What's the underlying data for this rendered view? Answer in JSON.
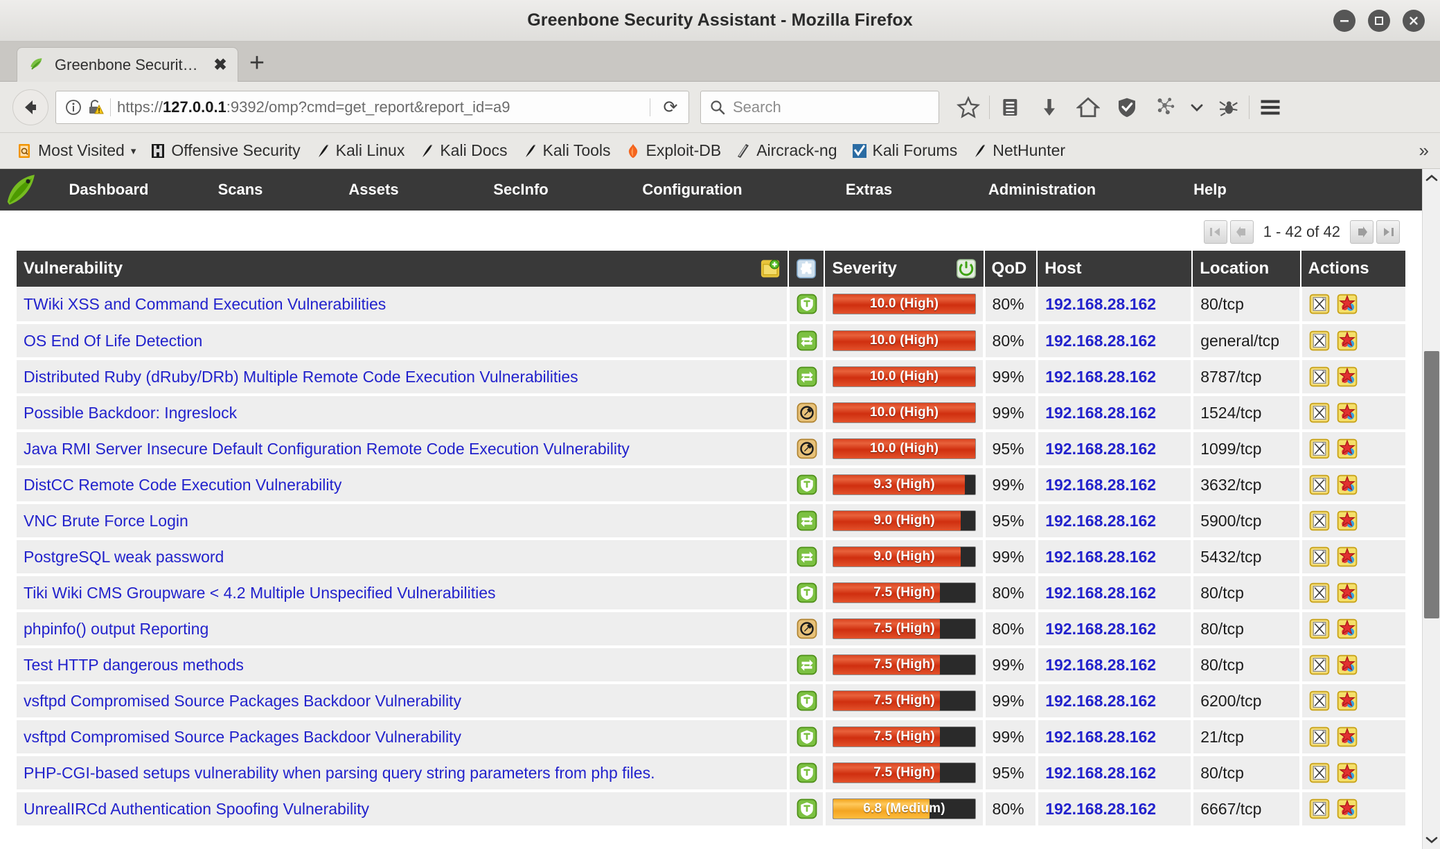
{
  "window": {
    "title": "Greenbone Security Assistant - Mozilla Firefox",
    "minimize": "minimize-button",
    "maximize": "maximize-button",
    "close": "close-button"
  },
  "tabs": {
    "active_tab_label": "Greenbone Security …",
    "close_label": "✖",
    "new_tab_label": "+"
  },
  "navbar": {
    "url": "https://127.0.0.1:9392/omp?cmd=get_report&report_id=a9",
    "url_bold": "127.0.0.1",
    "url_prefix": "https://",
    "url_suffix": ":9392/omp?cmd=get_report&report_id=a9",
    "reload_glyph": "⟳",
    "search_placeholder": "Search"
  },
  "bookmarks": {
    "items": [
      {
        "label": "Most Visited",
        "icon": "most-visited-icon",
        "has_chevron": true
      },
      {
        "label": "Offensive Security",
        "icon": "offensive-security-icon",
        "has_chevron": false
      },
      {
        "label": "Kali Linux",
        "icon": "kali-dragon-icon",
        "has_chevron": false
      },
      {
        "label": "Kali Docs",
        "icon": "kali-dragon-icon",
        "has_chevron": false
      },
      {
        "label": "Kali Tools",
        "icon": "kali-dragon-icon",
        "has_chevron": false
      },
      {
        "label": "Exploit-DB",
        "icon": "exploit-db-icon",
        "has_chevron": false
      },
      {
        "label": "Aircrack-ng",
        "icon": "aircrack-ng-icon",
        "has_chevron": false
      },
      {
        "label": "Kali Forums",
        "icon": "kali-forums-icon",
        "has_chevron": false
      },
      {
        "label": "NetHunter",
        "icon": "kali-dragon-icon",
        "has_chevron": false
      }
    ],
    "overflow_glyph": "»"
  },
  "gsa": {
    "menu": [
      "Dashboard",
      "Scans",
      "Assets",
      "SecInfo",
      "Configuration",
      "Extras",
      "Administration",
      "Help"
    ],
    "pager": {
      "first": "first-page",
      "prev": "previous-page",
      "range_label": "1 - 42 of 42",
      "next": "next-page",
      "last": "last-page"
    },
    "table": {
      "columns": [
        "Vulnerability",
        "",
        "Severity",
        "QoD",
        "Host",
        "Location",
        "Actions"
      ],
      "header_icons": {
        "new_note": "folder-add-icon",
        "solution_type": "puzzle-piece-icon",
        "severity_sort": "power-toggle-icon"
      },
      "rows": [
        {
          "name": "TWiki XSS and Command Execution Vulnerabilities",
          "solution": "vendorfix",
          "severity": "10.0 (High)",
          "score": 10.0,
          "level": "high",
          "qod": "80%",
          "host": "192.168.28.162",
          "location": "80/tcp"
        },
        {
          "name": "OS End Of Life Detection",
          "solution": "willnotfix",
          "severity": "10.0 (High)",
          "score": 10.0,
          "level": "high",
          "qod": "80%",
          "host": "192.168.28.162",
          "location": "general/tcp"
        },
        {
          "name": "Distributed Ruby (dRuby/DRb) Multiple Remote Code Execution Vulnerabilities",
          "solution": "willnotfix",
          "severity": "10.0 (High)",
          "score": 10.0,
          "level": "high",
          "qod": "99%",
          "host": "192.168.28.162",
          "location": "8787/tcp"
        },
        {
          "name": "Possible Backdoor: Ingreslock",
          "solution": "workaround",
          "severity": "10.0 (High)",
          "score": 10.0,
          "level": "high",
          "qod": "99%",
          "host": "192.168.28.162",
          "location": "1524/tcp"
        },
        {
          "name": "Java RMI Server Insecure Default Configuration Remote Code Execution Vulnerability",
          "solution": "workaround",
          "severity": "10.0 (High)",
          "score": 10.0,
          "level": "high",
          "qod": "95%",
          "host": "192.168.28.162",
          "location": "1099/tcp"
        },
        {
          "name": "DistCC Remote Code Execution Vulnerability",
          "solution": "vendorfix",
          "severity": "9.3 (High)",
          "score": 9.3,
          "level": "high",
          "qod": "99%",
          "host": "192.168.28.162",
          "location": "3632/tcp"
        },
        {
          "name": "VNC Brute Force Login",
          "solution": "willnotfix",
          "severity": "9.0 (High)",
          "score": 9.0,
          "level": "high",
          "qod": "95%",
          "host": "192.168.28.162",
          "location": "5900/tcp"
        },
        {
          "name": "PostgreSQL weak password",
          "solution": "willnotfix",
          "severity": "9.0 (High)",
          "score": 9.0,
          "level": "high",
          "qod": "99%",
          "host": "192.168.28.162",
          "location": "5432/tcp"
        },
        {
          "name": "Tiki Wiki CMS Groupware < 4.2 Multiple Unspecified Vulnerabilities",
          "solution": "vendorfix",
          "severity": "7.5 (High)",
          "score": 7.5,
          "level": "high",
          "qod": "80%",
          "host": "192.168.28.162",
          "location": "80/tcp"
        },
        {
          "name": "phpinfo() output Reporting",
          "solution": "workaround",
          "severity": "7.5 (High)",
          "score": 7.5,
          "level": "high",
          "qod": "80%",
          "host": "192.168.28.162",
          "location": "80/tcp"
        },
        {
          "name": "Test HTTP dangerous methods",
          "solution": "willnotfix",
          "severity": "7.5 (High)",
          "score": 7.5,
          "level": "high",
          "qod": "99%",
          "host": "192.168.28.162",
          "location": "80/tcp"
        },
        {
          "name": "vsftpd Compromised Source Packages Backdoor Vulnerability",
          "solution": "vendorfix",
          "severity": "7.5 (High)",
          "score": 7.5,
          "level": "high",
          "qod": "99%",
          "host": "192.168.28.162",
          "location": "6200/tcp"
        },
        {
          "name": "vsftpd Compromised Source Packages Backdoor Vulnerability",
          "solution": "vendorfix",
          "severity": "7.5 (High)",
          "score": 7.5,
          "level": "high",
          "qod": "99%",
          "host": "192.168.28.162",
          "location": "21/tcp"
        },
        {
          "name": "PHP-CGI-based setups vulnerability when parsing query string parameters from php files.",
          "solution": "vendorfix",
          "severity": "7.5 (High)",
          "score": 7.5,
          "level": "high",
          "qod": "95%",
          "host": "192.168.28.162",
          "location": "80/tcp"
        },
        {
          "name": "UnrealIRCd Authentication Spoofing Vulnerability",
          "solution": "vendorfix",
          "severity": "6.8 (Medium)",
          "score": 6.8,
          "level": "medium",
          "qod": "80%",
          "host": "192.168.28.162",
          "location": "6667/tcp"
        }
      ],
      "action_icons": [
        "add-note-icon",
        "add-override-icon"
      ]
    }
  },
  "colors": {
    "high": "#d9421f",
    "medium": "#f0a21c",
    "header_bg": "#393939",
    "link": "#2222cc"
  }
}
